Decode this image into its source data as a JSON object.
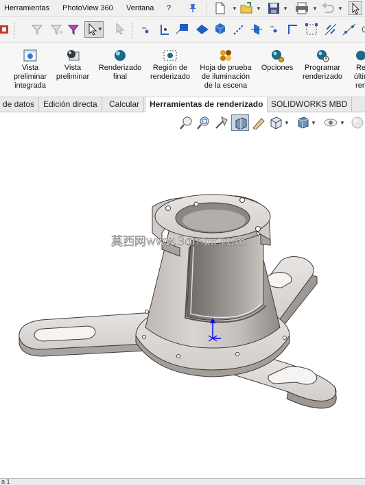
{
  "menu": {
    "items": [
      "Herramientas",
      "PhotoView 360",
      "Ventana",
      "?"
    ]
  },
  "ribbon": {
    "buttons": [
      {
        "label": "Vista\npreliminar\nintegrada",
        "icon": "render-preview-icon"
      },
      {
        "label": "Vista\npreliminar",
        "icon": "preview-window-icon"
      },
      {
        "label": "Renderizado\nfinal",
        "icon": "final-render-icon"
      },
      {
        "label": "Región de\nrenderizado",
        "icon": "render-region-icon"
      },
      {
        "label": "Hoja de prueba\nde iluminación\nde la escena",
        "icon": "lighting-proof-sheet-icon"
      },
      {
        "label": "Opciones",
        "icon": "options-icon"
      },
      {
        "label": "Programar\nrenderizado",
        "icon": "schedule-render-icon"
      },
      {
        "label": "Re\núltin\nren",
        "icon": "recall-last-render-icon"
      }
    ]
  },
  "tabs": {
    "items": [
      "de datos",
      "Edición directa",
      "Calcular",
      "Herramientas de renderizado",
      "SOLIDWORKS MBD"
    ],
    "active": "Herramientas de renderizado"
  },
  "watermark": "莫西网www.3dmox.com",
  "status": {
    "text": "a 1"
  },
  "colors": {
    "accent": "#1f5fbf",
    "part": "#c9c6c3",
    "part_dark": "#8d8a87",
    "triad": "#0000ff"
  }
}
